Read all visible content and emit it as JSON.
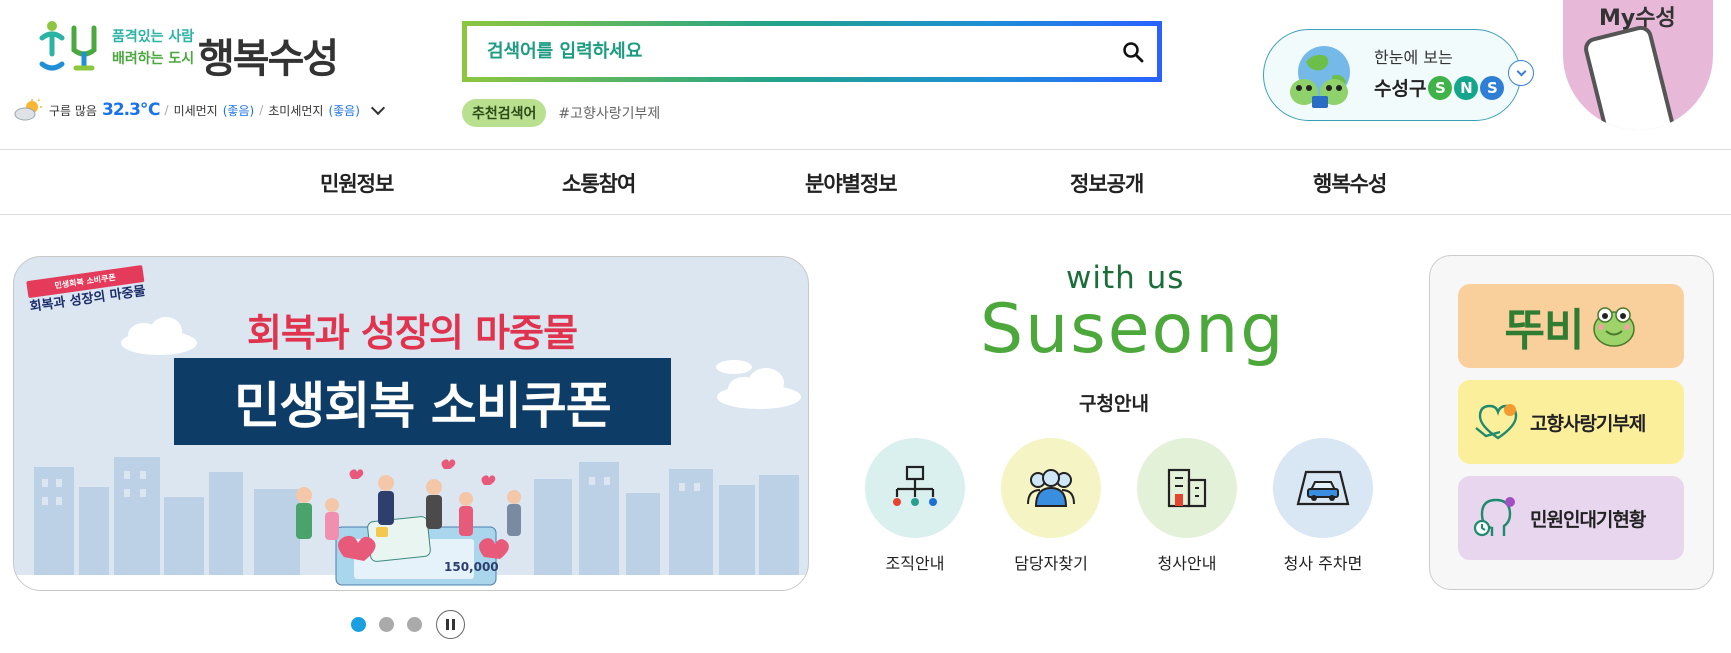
{
  "header": {
    "logo_slogan_line1": "품격있는 사람",
    "logo_slogan_line2": "배려하는 도시",
    "logo_brand": "행복수성",
    "weather": {
      "condition": "구름 많음",
      "temperature": "32.3℃",
      "fine_dust_label": "미세먼지",
      "fine_dust_status": "(좋음)",
      "ultrafine_dust_label": "초미세먼지",
      "ultrafine_dust_status": "(좋음)"
    },
    "search": {
      "placeholder": "검색어를 입력하세요"
    },
    "recommended": {
      "label": "추천검색어",
      "tags": [
        "#고향사랑기부제"
      ]
    },
    "sns": {
      "line1": "한눈에 보는",
      "line2": "수성구",
      "letters": [
        "S",
        "N",
        "S"
      ]
    },
    "my_label": "My수성"
  },
  "nav": {
    "items": [
      "민원정보",
      "소통참여",
      "분야별정보",
      "정보공개",
      "행복수성"
    ]
  },
  "banner": {
    "badge_small": "민생회복 소비쿠폰",
    "badge_title": "회복과 성장의 마중물",
    "subtitle": "회복과 성장의 마중물",
    "title": "민생회복 소비쿠폰",
    "note_value": "150,000",
    "slide_count": 3,
    "active_slide": 1
  },
  "withus": {
    "line1": "with us",
    "line2": "Suseong"
  },
  "guide": {
    "title": "구청안내",
    "items": [
      {
        "label": "조직안내",
        "icon": "org-chart-icon",
        "color": "#d9f0ee"
      },
      {
        "label": "담당자찾기",
        "icon": "people-icon",
        "color": "#f5f4c4"
      },
      {
        "label": "청사안내",
        "icon": "building-icon",
        "color": "#e4f1d9"
      },
      {
        "label": "청사 주차면",
        "icon": "parking-car-icon",
        "color": "#d9e6f3"
      }
    ]
  },
  "quick": {
    "ttubi": "뚜비",
    "hometown": "고향사랑기부제",
    "waiting": "민원인대기현황"
  }
}
